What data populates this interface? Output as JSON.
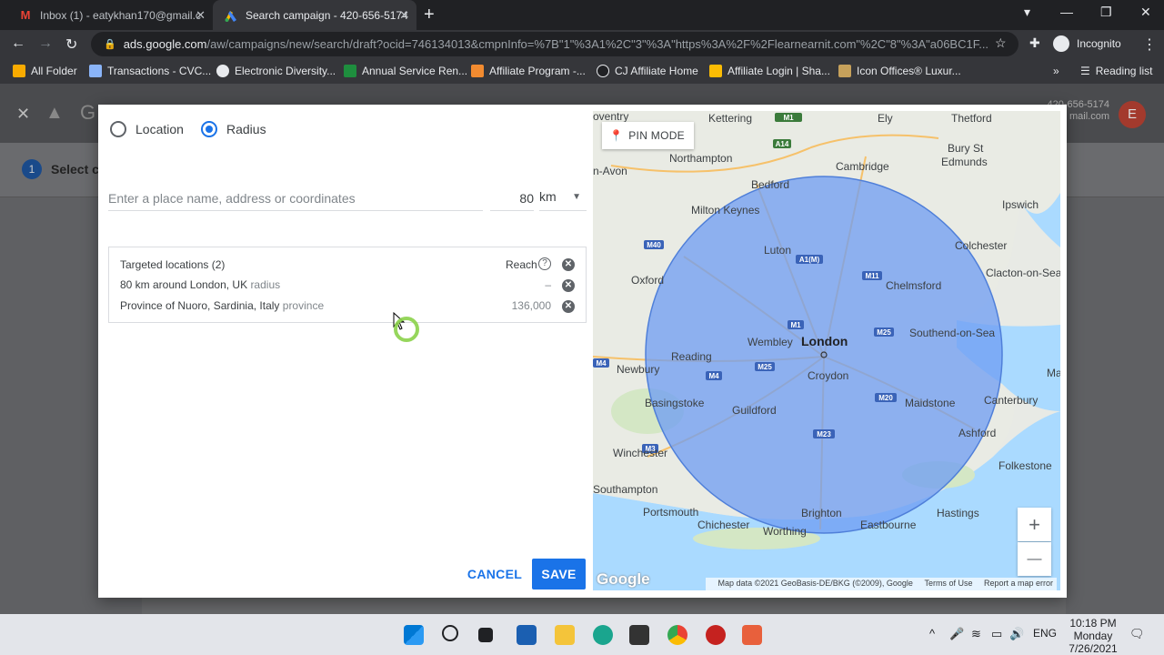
{
  "browser": {
    "tabs": [
      {
        "title": "Inbox (1) - eatykhan170@gmail.c",
        "icon": "gmail-icon"
      },
      {
        "title": "Search campaign - 420-656-5174",
        "icon": "google-ads-icon"
      }
    ],
    "url_host": "ads.google.com",
    "url_path": "/aw/campaigns/new/search/draft?ocid=746134013&cmpnInfo=%7B\"1\"%3A1%2C\"3\"%3A\"https%3A%2F%2Flearnearnit.com\"%2C\"8\"%3A\"a06BC1F...",
    "profile_label": "Incognito",
    "bookmarks": [
      "All Folder",
      "Transactions - CVC...",
      "Electronic Diversity...",
      "Annual Service Ren...",
      "Affiliate Program -...",
      "CJ Affiliate Home",
      "Affiliate Login | Sha...",
      "Icon Offices® Luxur..."
    ],
    "reading_list": "Reading list"
  },
  "ads_page": {
    "step_number": "1",
    "step_label": "Select c",
    "account_phone": "420-656-5174",
    "account_email": "mail.com",
    "avatar_letter": "E"
  },
  "dialog": {
    "radio_location": "Location",
    "radio_radius": "Radius",
    "place_placeholder": "Enter a place name, address or coordinates",
    "radius_value": "80",
    "radius_unit": "km",
    "targeted_header": "Targeted locations (2)",
    "reach_header": "Reach",
    "targets": [
      {
        "name": "80 km around London, UK",
        "kind": "radius",
        "reach": "–"
      },
      {
        "name": "Province of Nuoro, Sardinia, Italy",
        "kind": "province",
        "reach": "136,000"
      }
    ],
    "cancel_label": "CANCEL",
    "save_label": "SAVE"
  },
  "map": {
    "pin_mode_label": "PIN MODE",
    "zoom_in": "+",
    "zoom_out": "—",
    "google_logo": "Google",
    "attribution": "Map data ©2021 GeoBasis-DE/BKG (©2009), Google",
    "terms": "Terms of Use",
    "report": "Report a map error",
    "cities": {
      "coventry": "oventry",
      "kettering": "Kettering",
      "ely": "Ely",
      "thetford": "Thetford",
      "northampton": "Northampton",
      "cambridge": "Cambridge",
      "bury": "Bury St\nEdmunds",
      "banbury": "n-Avon",
      "bedford": "Bedford",
      "miltonkeynes": "Milton Keynes",
      "ipswich": "Ipswich",
      "luton": "Luton",
      "colchester": "Colchester",
      "oxford": "Oxford",
      "chelmsford": "Chelmsford",
      "clacton": "Clacton-on-Sea",
      "wembley": "Wembley",
      "london": "London",
      "southend": "Southend-on-Sea",
      "reading": "Reading",
      "newbury": "Newbury",
      "croydon": "Croydon",
      "margate": "Marg",
      "canterbury": "Canterbury",
      "basingstoke": "Basingstoke",
      "maidstone": "Maidstone",
      "guildford": "Guildford",
      "ashford": "Ashford",
      "winchester": "Winchester",
      "folkestone": "Folkestone",
      "southampton": "Southampton",
      "portsmouth": "Portsmouth",
      "chichester": "Chichester",
      "brighton": "Brighton",
      "worthing": "Worthing",
      "eastbourne": "Eastbourne",
      "hastings": "Hastings"
    },
    "roads": [
      "A14",
      "M40",
      "A1(M)",
      "M11",
      "M1",
      "M25",
      "M4",
      "M20",
      "M3",
      "M23",
      "A1(M)"
    ]
  },
  "taskbar": {
    "time": "10:18 PM",
    "day": "Monday",
    "date": "7/26/2021",
    "lang": "ENG"
  }
}
